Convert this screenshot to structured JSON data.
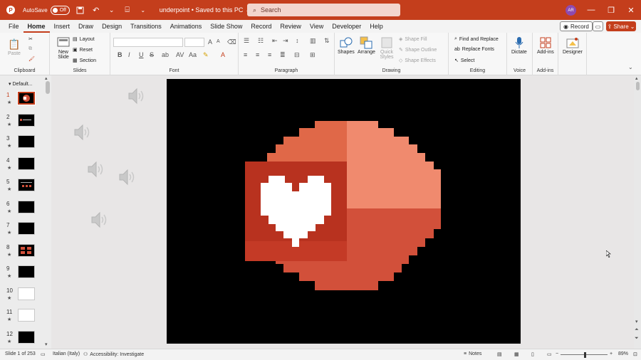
{
  "titlebar": {
    "autosave_label": "AutoSave",
    "toggle_label": "Off",
    "doc_title": "underpoint • Saved to this PC",
    "search_placeholder": "Search",
    "avatar_initials": "AR"
  },
  "menu": {
    "tabs": [
      "File",
      "Home",
      "Insert",
      "Draw",
      "Design",
      "Transitions",
      "Animations",
      "Slide Show",
      "Record",
      "Review",
      "View",
      "Developer",
      "Help"
    ],
    "active": "Home",
    "record_label": "Record",
    "share_label": "Share"
  },
  "ribbon": {
    "clipboard": {
      "paste": "Paste",
      "label": "Clipboard"
    },
    "slides": {
      "new_slide": "New Slide",
      "layout": "Layout",
      "reset": "Reset",
      "section": "Section",
      "label": "Slides"
    },
    "font": {
      "label": "Font",
      "buttons": [
        "B",
        "I",
        "U",
        "S",
        "ab",
        "AV",
        "Aa"
      ]
    },
    "paragraph": {
      "label": "Paragraph"
    },
    "drawing": {
      "shapes": "Shapes",
      "arrange": "Arrange",
      "quick_styles": "Quick Styles",
      "shape_fill": "Shape Fill",
      "shape_outline": "Shape Outline",
      "shape_effects": "Shape Effects",
      "label": "Drawing"
    },
    "editing": {
      "find_replace": "Find and Replace",
      "replace_fonts": "Replace Fonts",
      "select": "Select",
      "label": "Editing"
    },
    "voice": {
      "dictate": "Dictate",
      "label": "Voice"
    },
    "addins": {
      "addins": "Add-ins",
      "label": "Add-ins"
    },
    "designer": {
      "designer": "Designer"
    }
  },
  "slides_panel": {
    "section_name": "Default...",
    "thumbs": [
      {
        "num": "1",
        "kind": "logo"
      },
      {
        "num": "2",
        "kind": "title"
      },
      {
        "num": "3",
        "kind": "dark"
      },
      {
        "num": "4",
        "kind": "dark"
      },
      {
        "num": "5",
        "kind": "dots"
      },
      {
        "num": "6",
        "kind": "dark"
      },
      {
        "num": "7",
        "kind": "dark"
      },
      {
        "num": "8",
        "kind": "red"
      },
      {
        "num": "9",
        "kind": "dark"
      },
      {
        "num": "10",
        "kind": "white"
      },
      {
        "num": "11",
        "kind": "white"
      },
      {
        "num": "12",
        "kind": "dark"
      }
    ]
  },
  "slide": {
    "colors": {
      "circle_dark": "#d2503a",
      "circle_light": "#f08a6e",
      "circle_mid": "#e06848",
      "square": "#b8321f",
      "heart": "#ffffff"
    }
  },
  "status": {
    "slide_count": "Slide 1 of 253",
    "language": "Italian (Italy)",
    "accessibility": "Accessibility: Investigate",
    "notes": "Notes",
    "zoom": "89%"
  }
}
